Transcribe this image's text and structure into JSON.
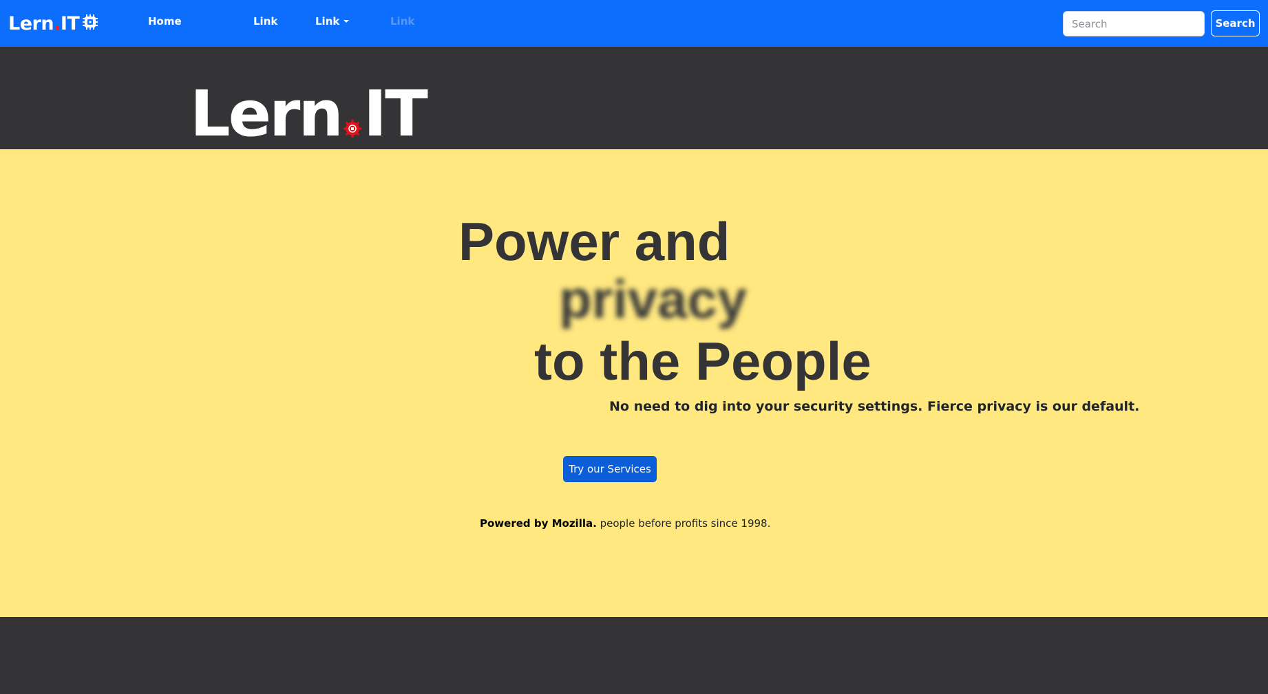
{
  "navbar": {
    "brand": {
      "text_main": "Lern",
      "text_dot": ".",
      "text_tail": "IT",
      "icon": "chip-icon"
    },
    "links": [
      {
        "label": "Home",
        "state": "active"
      },
      {
        "label": "Link",
        "state": "normal"
      },
      {
        "label": "Link",
        "state": "dropdown"
      },
      {
        "label": "Link",
        "state": "disabled"
      }
    ],
    "search": {
      "placeholder": "Search",
      "value": "",
      "button_label": "Search"
    }
  },
  "logo": {
    "text_main": "Lern",
    "text_tail": "IT",
    "icon": "gear-dot-icon"
  },
  "hero": {
    "headline_line1": "Power and",
    "headline_line2": "privacy",
    "headline_line3": "to the People",
    "subline": "No need to dig into your security settings. Fierce privacy is our default.",
    "cta_label": "Try our Services",
    "powered_bold": "Powered by Mozilla.",
    "powered_rest": " people before profits since 1998."
  },
  "colors": {
    "navbar": "#0d6efd",
    "dark_band": "#343437",
    "hero_bg": "#ffe880",
    "cta": "#0b5ed7",
    "accent_red": "#ff1a1a"
  }
}
